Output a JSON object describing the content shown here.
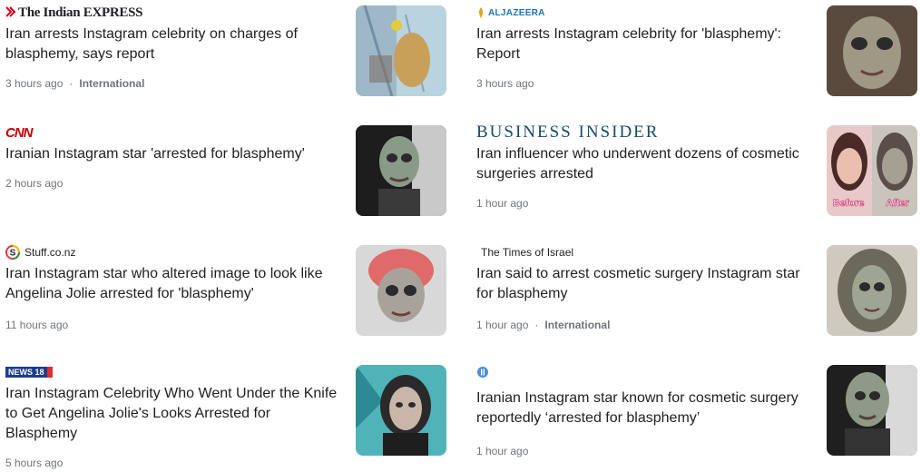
{
  "articles": [
    {
      "source": "The Indian EXPRESS",
      "title": "Iran arrests Instagram celebrity on charges of blasphemy, says report",
      "time": "3 hours ago",
      "category": "International"
    },
    {
      "source": "ALJAZEERA",
      "title": "Iran arrests Instagram celebrity for 'blasphemy': Report",
      "time": "3 hours ago",
      "category": ""
    },
    {
      "source": "CNN",
      "title": "Iranian Instagram star 'arrested for blasphemy'",
      "time": "2 hours ago",
      "category": ""
    },
    {
      "source": "BUSINESS INSIDER",
      "title": "Iran influencer who underwent dozens of cosmetic surgeries arrested",
      "time": "1 hour ago",
      "category": "",
      "thumb_labels": [
        "Before",
        "After"
      ]
    },
    {
      "source": "Stuff.co.nz",
      "title": "Iran Instagram star who altered image to look like Angelina Jolie arrested for 'blasphemy'",
      "time": "11 hours ago",
      "category": ""
    },
    {
      "source": "The Times of Israel",
      "title": "Iran said to arrest cosmetic surgery Instagram star for blasphemy",
      "time": "1 hour ago",
      "category": "International"
    },
    {
      "source": "NEWS 18",
      "title": "Iran Instagram Celebrity Who Went Under the Knife to Get Angelina Jolie's Looks Arrested for Blasphemy",
      "time": "5 hours ago",
      "category": ""
    },
    {
      "source": "",
      "title": "Iranian Instagram star known for cosmetic surgery reportedly ‘arrested for blasphemy’",
      "time": "1 hour ago",
      "category": ""
    }
  ],
  "colors": {
    "indian_express_red": "#d0021b",
    "aljazeera_blue": "#1a73b8",
    "aljazeera_gold": "#e8a317",
    "cnn_red": "#cc0000",
    "business_insider": "#174a6a",
    "news18_blue": "#1d3c8f",
    "news18_red": "#e32b2b",
    "meta_grey": "#70757a"
  }
}
